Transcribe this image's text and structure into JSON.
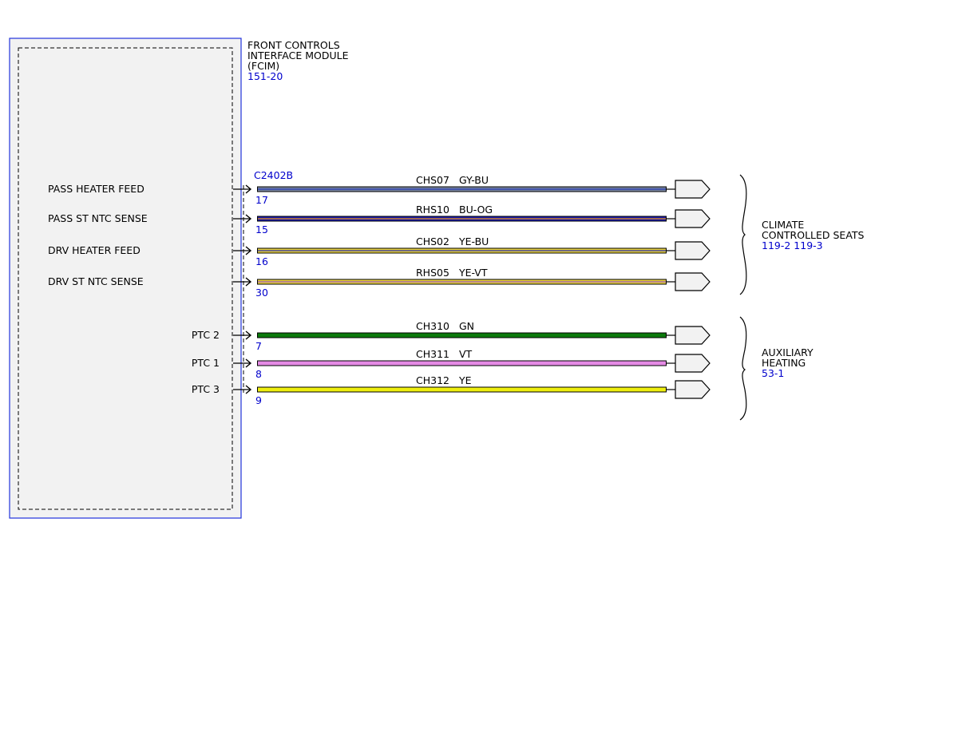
{
  "module": {
    "name_lines": [
      "FRONT CONTROLS",
      "INTERFACE MODULE",
      "(FCIM)"
    ],
    "ref": "151-20",
    "connector": "C2402B"
  },
  "signals": [
    {
      "label": "PASS HEATER FEED",
      "pin": "17",
      "circuit": "CHS07",
      "color_code": "GY-BU",
      "wire_color": "#7a86a0",
      "stripe_color": "#2a3fb0",
      "group": "seats"
    },
    {
      "label": "PASS ST NTC SENSE",
      "pin": "15",
      "circuit": "RHS10",
      "color_code": "BU-OG",
      "wire_color": "#1a1aa8",
      "stripe_color": "#d88a2a",
      "group": "seats"
    },
    {
      "label": "DRV HEATER FEED",
      "pin": "16",
      "circuit": "CHS02",
      "color_code": "YE-BU",
      "wire_color": "#e8d23a",
      "stripe_color": "#3a3aa0",
      "group": "seats"
    },
    {
      "label": "DRV ST NTC SENSE",
      "pin": "30",
      "circuit": "RHS05",
      "color_code": "YE-VT",
      "wire_color": "#e8d23a",
      "stripe_color": "#a060b0",
      "group": "seats"
    },
    {
      "label": "PTC 2",
      "pin": "7",
      "circuit": "CH310",
      "color_code": "GN",
      "wire_color": "#0c7a0c",
      "stripe_color": "",
      "group": "aux"
    },
    {
      "label": "PTC 1",
      "pin": "8",
      "circuit": "CH311",
      "color_code": "VT",
      "wire_color": "#e48ae4",
      "stripe_color": "",
      "group": "aux"
    },
    {
      "label": "PTC 3",
      "pin": "9",
      "circuit": "CH312",
      "color_code": "YE",
      "wire_color": "#eeee10",
      "stripe_color": "",
      "group": "aux"
    }
  ],
  "destinations": {
    "seats": {
      "name_lines": [
        "CLIMATE",
        "CONTROLLED SEATS"
      ],
      "ref": "119-2  119-3"
    },
    "aux": {
      "name_lines": [
        "AUXILIARY",
        "HEATING"
      ],
      "ref": "53-1"
    }
  }
}
